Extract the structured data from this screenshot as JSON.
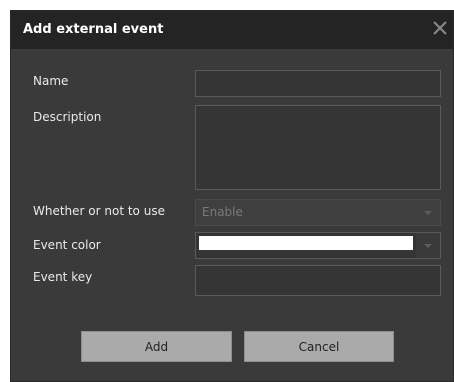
{
  "dialog": {
    "title": "Add external event",
    "close_icon": "close-icon"
  },
  "form": {
    "name": {
      "label": "Name",
      "value": ""
    },
    "description": {
      "label": "Description",
      "value": ""
    },
    "use": {
      "label": "Whether or not to use",
      "selected": "Enable",
      "disabled": true
    },
    "event_color": {
      "label": "Event color",
      "value": "#ffffff"
    },
    "event_key": {
      "label": "Event key",
      "value": ""
    }
  },
  "buttons": {
    "add_label": "Add",
    "cancel_label": "Cancel"
  }
}
